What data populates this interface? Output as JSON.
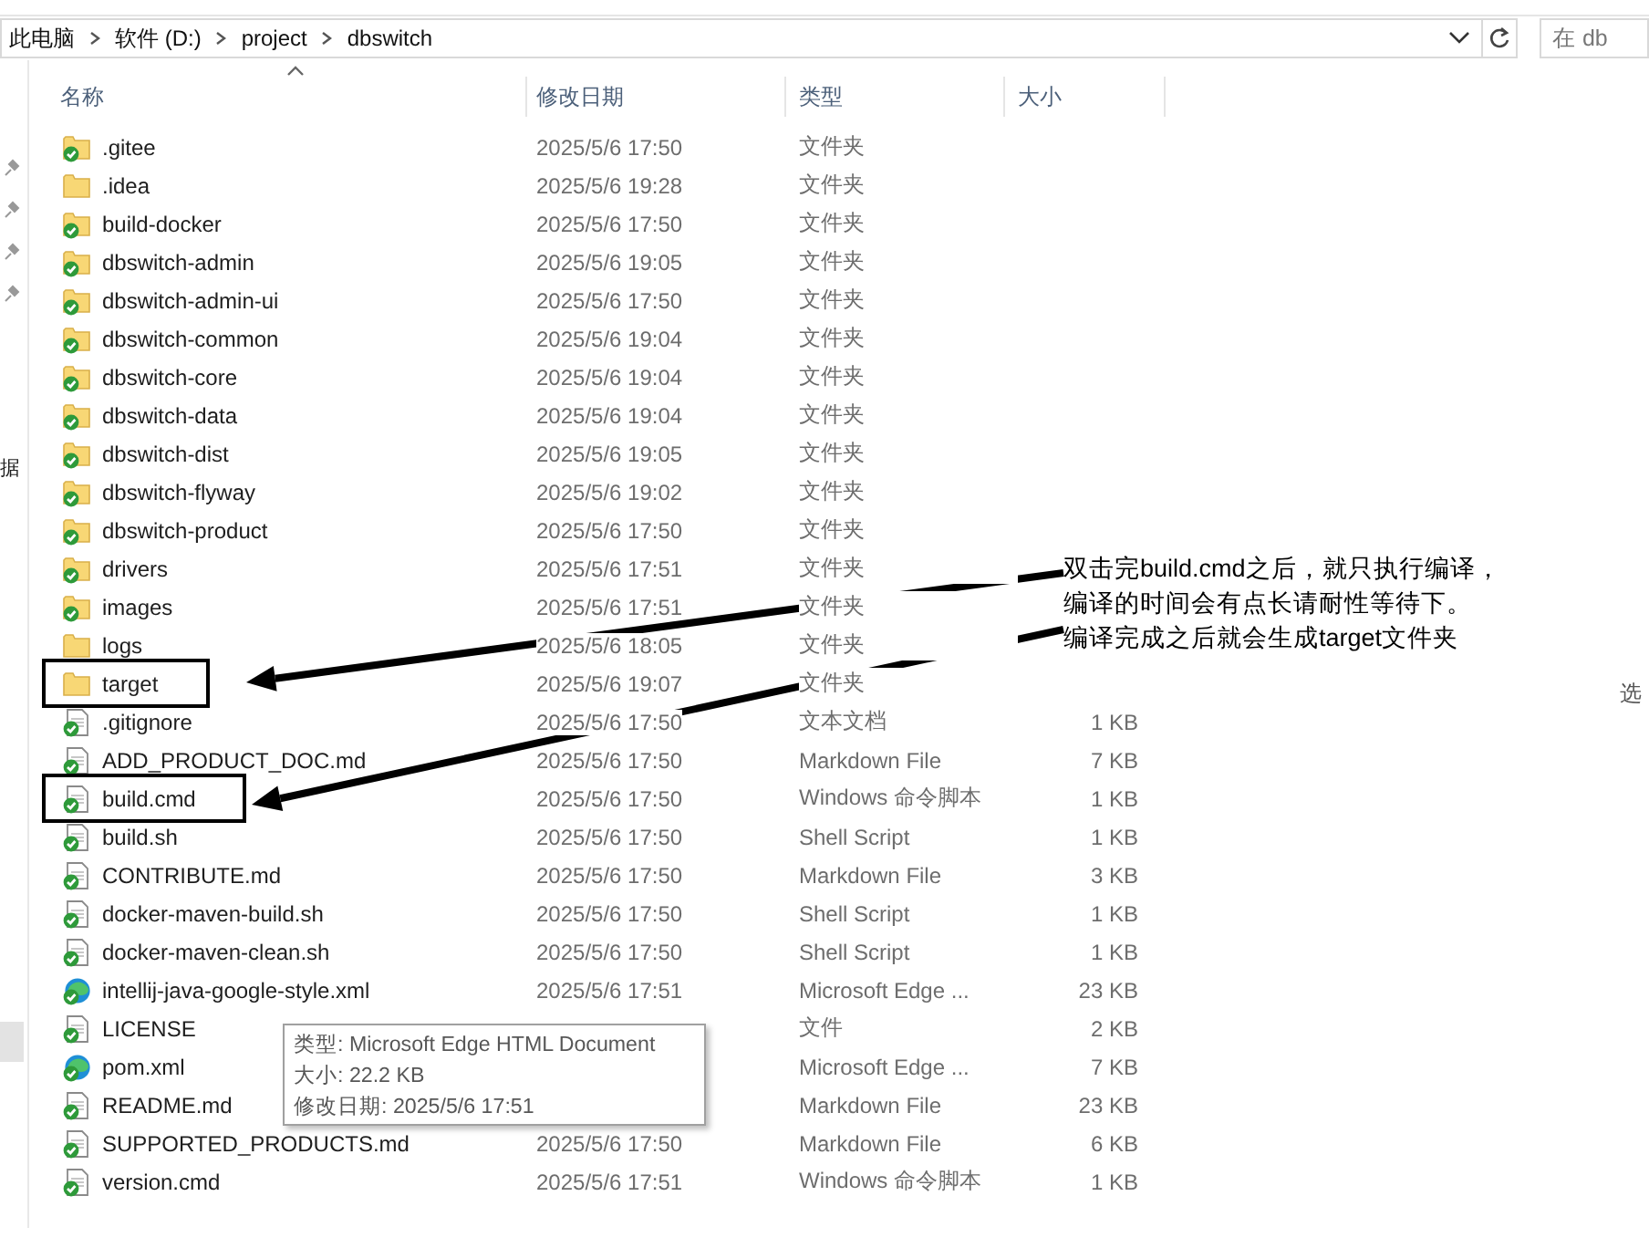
{
  "address_bar": {
    "segments": [
      "此电脑",
      "软件 (D:)",
      "project",
      "dbswitch"
    ]
  },
  "search": {
    "placeholder": "在 db"
  },
  "nav_pane": {
    "label": "据"
  },
  "details_pane": {
    "label": "选"
  },
  "columns": [
    "名称",
    "修改日期",
    "类型",
    "大小"
  ],
  "rows": [
    {
      "name": ".gitee",
      "date": "2025/5/6 17:50",
      "type": "文件夹",
      "kind": "folder",
      "synced": true,
      "highlighted": false
    },
    {
      "name": ".idea",
      "date": "2025/5/6 19:28",
      "type": "文件夹",
      "kind": "folder",
      "synced": false,
      "highlighted": false
    },
    {
      "name": "build-docker",
      "date": "2025/5/6 17:50",
      "type": "文件夹",
      "kind": "folder",
      "synced": true,
      "highlighted": false
    },
    {
      "name": "dbswitch-admin",
      "date": "2025/5/6 19:05",
      "type": "文件夹",
      "kind": "folder",
      "synced": true,
      "highlighted": false
    },
    {
      "name": "dbswitch-admin-ui",
      "date": "2025/5/6 17:50",
      "type": "文件夹",
      "kind": "folder",
      "synced": true,
      "highlighted": false
    },
    {
      "name": "dbswitch-common",
      "date": "2025/5/6 19:04",
      "type": "文件夹",
      "kind": "folder",
      "synced": true,
      "highlighted": false
    },
    {
      "name": "dbswitch-core",
      "date": "2025/5/6 19:04",
      "type": "文件夹",
      "kind": "folder",
      "synced": true,
      "highlighted": false
    },
    {
      "name": "dbswitch-data",
      "date": "2025/5/6 19:04",
      "type": "文件夹",
      "kind": "folder",
      "synced": true,
      "highlighted": false
    },
    {
      "name": "dbswitch-dist",
      "date": "2025/5/6 19:05",
      "type": "文件夹",
      "kind": "folder",
      "synced": true,
      "highlighted": false
    },
    {
      "name": "dbswitch-flyway",
      "date": "2025/5/6 19:02",
      "type": "文件夹",
      "kind": "folder",
      "synced": true,
      "highlighted": false
    },
    {
      "name": "dbswitch-product",
      "date": "2025/5/6 17:50",
      "type": "文件夹",
      "kind": "folder",
      "synced": true,
      "highlighted": false
    },
    {
      "name": "drivers",
      "date": "2025/5/6 17:51",
      "type": "文件夹",
      "kind": "folder",
      "synced": true,
      "highlighted": false
    },
    {
      "name": "images",
      "date": "2025/5/6 17:51",
      "type": "文件夹",
      "kind": "folder",
      "synced": true,
      "highlighted": false
    },
    {
      "name": "logs",
      "date": "2025/5/6 18:05",
      "type": "文件夹",
      "kind": "folder",
      "synced": false,
      "highlighted": false
    },
    {
      "name": "target",
      "date": "2025/5/6 19:07",
      "type": "文件夹",
      "kind": "folder",
      "synced": false,
      "highlighted": true
    },
    {
      "name": ".gitignore",
      "date": "2025/5/6 17:50",
      "type": "文本文档",
      "size": "1 KB",
      "kind": "file",
      "synced": true,
      "highlighted": false
    },
    {
      "name": "ADD_PRODUCT_DOC.md",
      "date": "2025/5/6 17:50",
      "type": "Markdown File",
      "size": "7 KB",
      "kind": "file",
      "synced": true,
      "highlighted": false
    },
    {
      "name": "build.cmd",
      "date": "2025/5/6 17:50",
      "type": "Windows 命令脚本",
      "size": "1 KB",
      "kind": "file",
      "synced": true,
      "highlighted": true
    },
    {
      "name": "build.sh",
      "date": "2025/5/6 17:50",
      "type": "Shell Script",
      "size": "1 KB",
      "kind": "file",
      "synced": true,
      "highlighted": false
    },
    {
      "name": "CONTRIBUTE.md",
      "date": "2025/5/6 17:50",
      "type": "Markdown File",
      "size": "3 KB",
      "kind": "file",
      "synced": true,
      "highlighted": false
    },
    {
      "name": "docker-maven-build.sh",
      "date": "2025/5/6 17:50",
      "type": "Shell Script",
      "size": "1 KB",
      "kind": "file",
      "synced": true,
      "highlighted": false
    },
    {
      "name": "docker-maven-clean.sh",
      "date": "2025/5/6 17:50",
      "type": "Shell Script",
      "size": "1 KB",
      "kind": "file",
      "synced": true,
      "highlighted": false
    },
    {
      "name": "intellij-java-google-style.xml",
      "date": "2025/5/6 17:51",
      "type": "Microsoft Edge ...",
      "size": "23 KB",
      "kind": "edge",
      "synced": true,
      "highlighted": false
    },
    {
      "name": "LICENSE",
      "type": "文件",
      "size": "2 KB",
      "kind": "file",
      "synced": true,
      "highlighted": false
    },
    {
      "name": "pom.xml",
      "type": "Microsoft Edge ...",
      "size": "7 KB",
      "kind": "edge",
      "synced": true,
      "highlighted": false
    },
    {
      "name": "README.md",
      "type": "Markdown File",
      "size": "23 KB",
      "kind": "file",
      "synced": true,
      "highlighted": false
    },
    {
      "name": "SUPPORTED_PRODUCTS.md",
      "date": "2025/5/6 17:50",
      "type": "Markdown File",
      "size": "6 KB",
      "kind": "file",
      "synced": true,
      "highlighted": false
    },
    {
      "name": "version.cmd",
      "date": "2025/5/6 17:51",
      "type": "Windows 命令脚本",
      "size": "1 KB",
      "kind": "file",
      "synced": true,
      "highlighted": false
    }
  ],
  "tooltip": {
    "lines": [
      "类型: Microsoft Edge HTML Document",
      "大小: 22.2 KB",
      "修改日期: 2025/5/6 17:51"
    ]
  },
  "annotation": {
    "lines": [
      "双击完build.cmd之后，就只执行编译，",
      "编译的时间会有点长请耐性等待下。",
      "编译完成之后就会生成target文件夹"
    ]
  }
}
